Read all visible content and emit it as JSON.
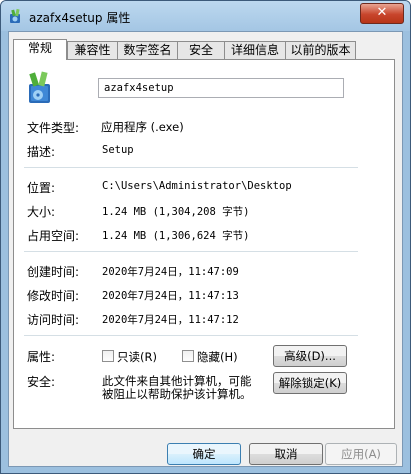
{
  "window": {
    "title": "azafx4setup 属性",
    "close_label": "✕"
  },
  "tabs": [
    {
      "label": "常规",
      "active": true
    },
    {
      "label": "兼容性"
    },
    {
      "label": "数字签名"
    },
    {
      "label": "安全"
    },
    {
      "label": "详细信息"
    },
    {
      "label": "以前的版本"
    }
  ],
  "general": {
    "file_name": "azafx4setup",
    "file_type_label": "文件类型:",
    "file_type_value": "应用程序 (.exe)",
    "description_label": "描述:",
    "description_value": "Setup",
    "location_label": "位置:",
    "location_value": "C:\\Users\\Administrator\\Desktop",
    "size_label": "大小:",
    "size_value": "1.24 MB (1,304,208 字节)",
    "size_on_disk_label": "占用空间:",
    "size_on_disk_value": "1.24 MB (1,306,624 字节)",
    "created_label": "创建时间:",
    "created_value": "2020年7月24日，11:47:09",
    "modified_label": "修改时间:",
    "modified_value": "2020年7月24日，11:47:13",
    "accessed_label": "访问时间:",
    "accessed_value": "2020年7月24日，11:47:12",
    "attributes_label": "属性:",
    "readonly_label": "只读(R)",
    "hidden_label": "隐藏(H)",
    "advanced_button": "高级(D)...",
    "security_label": "安全:",
    "security_text_line1": "此文件来自其他计算机，可能",
    "security_text_line2": "被阻止以帮助保护该计算机。",
    "unblock_button": "解除锁定(K)"
  },
  "footer": {
    "ok": "确定",
    "cancel": "取消",
    "apply": "应用(A)"
  }
}
